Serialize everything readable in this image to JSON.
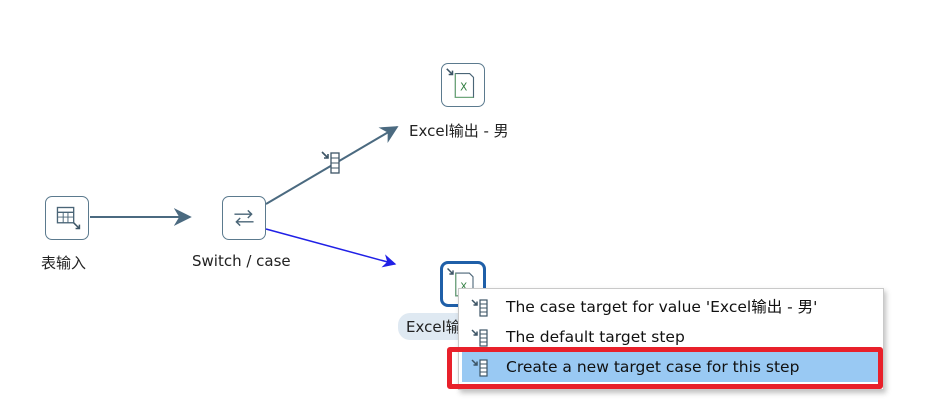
{
  "steps": {
    "table_input": {
      "label": "表输入",
      "icon": "table-input-icon"
    },
    "switch_case": {
      "label": "Switch / case",
      "icon": "switch-arrows-icon"
    },
    "excel_male": {
      "label": "Excel输出 - 男",
      "icon": "excel-output-icon"
    },
    "excel_selected": {
      "label": "Excel输",
      "icon": "excel-output-icon"
    }
  },
  "hops": {
    "copy_hop_icon": "copy-rows-icon"
  },
  "context_menu": {
    "items": [
      {
        "label": "The case target for value 'Excel输出 - 男'",
        "icon": "hop-target-icon"
      },
      {
        "label": "The default target step",
        "icon": "hop-target-icon"
      },
      {
        "label": "Create a new target case for this step",
        "icon": "hop-target-icon",
        "selected": true
      }
    ]
  },
  "colors": {
    "hop": "#4b6a80",
    "new_hop": "#2020e6",
    "menu_selected": "#99c9f3",
    "annotation_red": "#e8202a"
  }
}
